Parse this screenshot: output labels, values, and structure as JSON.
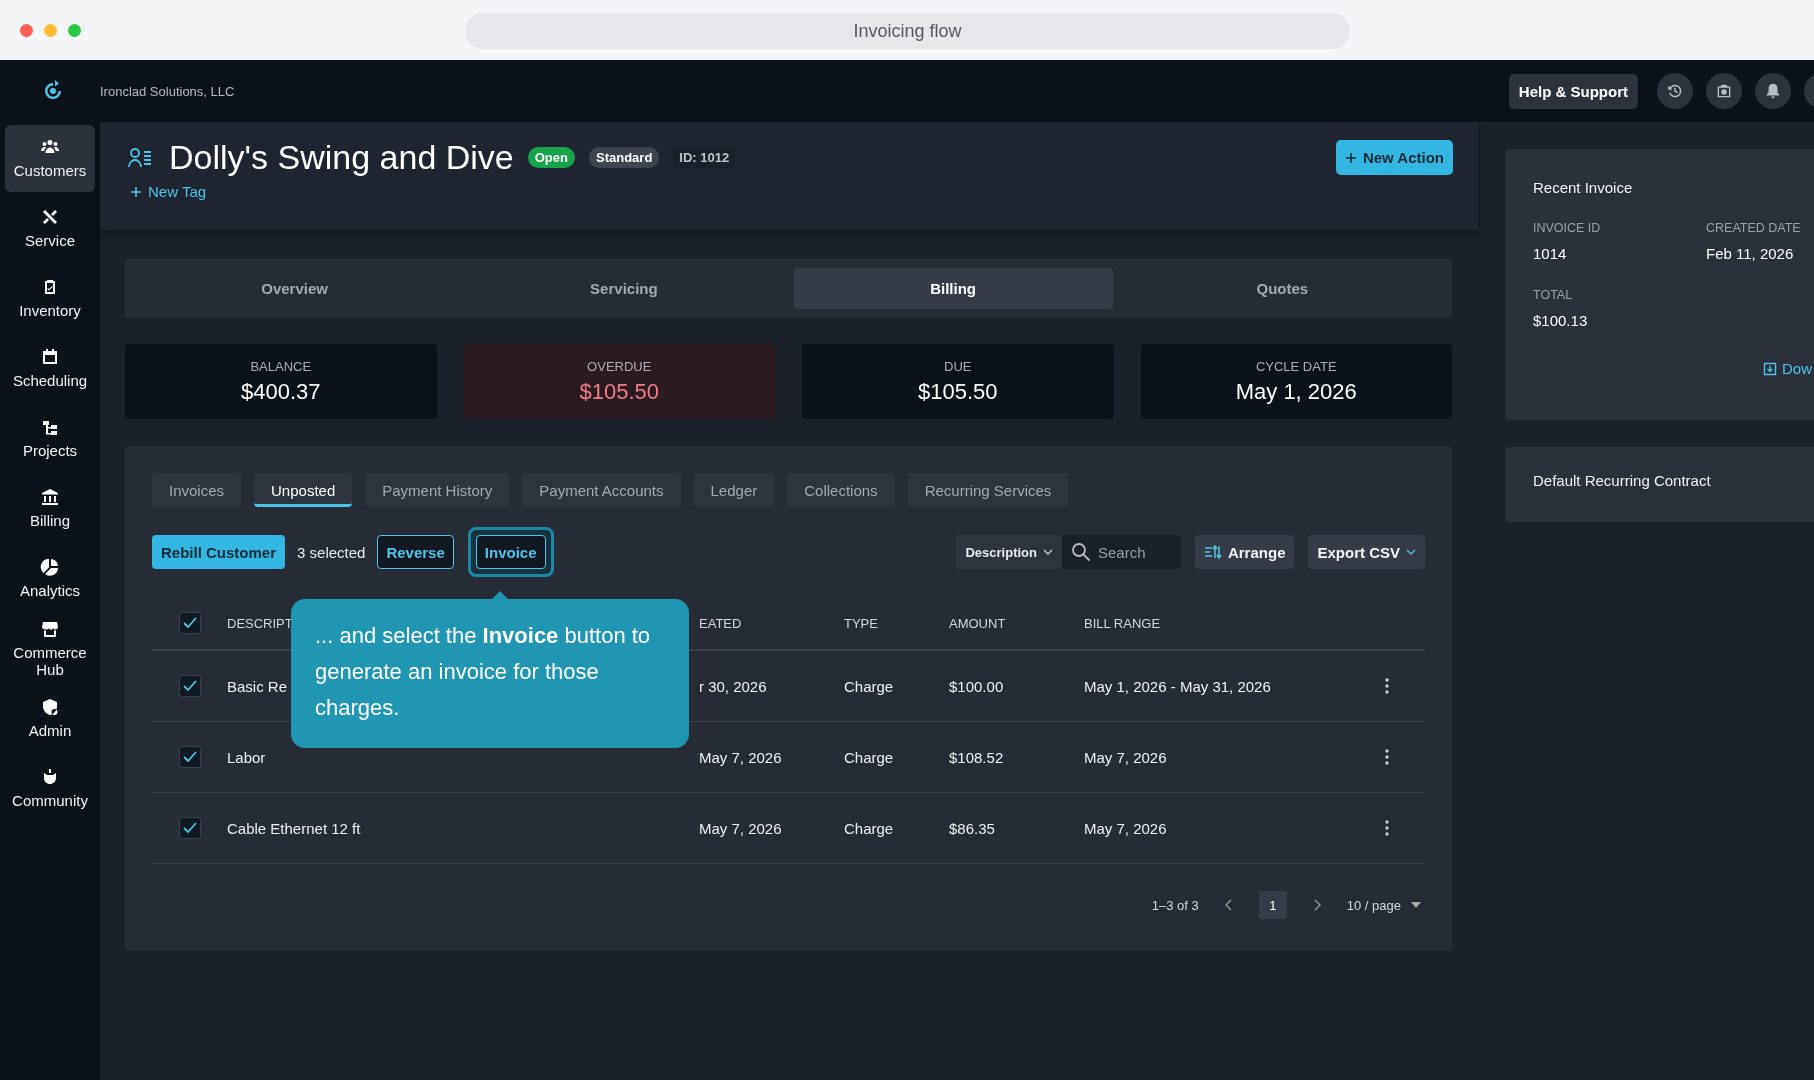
{
  "window": {
    "title": "Invoicing flow"
  },
  "top_bar": {
    "company": "Ironclad Solutions, LLC",
    "help_button": "Help & Support"
  },
  "sidebar": {
    "items": [
      {
        "label": "Customers",
        "selected": true
      },
      {
        "label": "Service",
        "selected": false
      },
      {
        "label": "Inventory",
        "selected": false
      },
      {
        "label": "Scheduling",
        "selected": false
      },
      {
        "label": "Projects",
        "selected": false
      },
      {
        "label": "Billing",
        "selected": false
      },
      {
        "label": "Analytics",
        "selected": false
      },
      {
        "label": "Commerce Hub",
        "selected": false
      },
      {
        "label": "Admin",
        "selected": false
      },
      {
        "label": "Community",
        "selected": false
      }
    ]
  },
  "customer": {
    "name": "Dolly's Swing and Dive",
    "tags": [
      {
        "label": "Open",
        "color": "#16a34a"
      },
      {
        "label": "Standard",
        "color": "#3d444f"
      }
    ],
    "id_label": "ID: 1012",
    "new_tag": "New Tag",
    "new_action": "New Action"
  },
  "tabs": [
    {
      "label": "Overview",
      "selected": false
    },
    {
      "label": "Servicing",
      "selected": false
    },
    {
      "label": "Billing",
      "selected": true
    },
    {
      "label": "Quotes",
      "selected": false
    }
  ],
  "stats": [
    {
      "label": "BALANCE",
      "value": "$400.37",
      "overdue": false
    },
    {
      "label": "OVERDUE",
      "value": "$105.50",
      "overdue": true
    },
    {
      "label": "DUE",
      "value": "$105.50",
      "overdue": false
    },
    {
      "label": "CYCLE DATE",
      "value": "May 1, 2026",
      "overdue": false
    }
  ],
  "billing": {
    "subtabs": [
      {
        "label": "Invoices",
        "selected": false
      },
      {
        "label": "Unposted",
        "selected": true
      },
      {
        "label": "Payment History",
        "selected": false
      },
      {
        "label": "Payment Accounts",
        "selected": false
      },
      {
        "label": "Ledger",
        "selected": false
      },
      {
        "label": "Collections",
        "selected": false
      },
      {
        "label": "Recurring Services",
        "selected": false
      }
    ],
    "toolbar": {
      "rebill": "Rebill Customer",
      "selected_count": "3 selected",
      "reverse": "Reverse",
      "invoice": "Invoice",
      "filter": "Description",
      "search_placeholder": "Search",
      "arrange": "Arrange",
      "export": "Export CSV"
    },
    "table": {
      "select_all": {
        "checked": true
      },
      "columns": [
        "DESCRIPT",
        "EATED",
        "TYPE",
        "AMOUNT",
        "BILL RANGE"
      ],
      "rows": [
        {
          "checked": true,
          "cells": [
            "Basic Re",
            "r 30, 2026",
            "Charge",
            "$100.00",
            "May 1, 2026 - May 31, 2026"
          ]
        },
        {
          "checked": true,
          "cells": [
            "Labor",
            "May 7, 2026",
            "Charge",
            "$108.52",
            "May 7, 2026"
          ]
        },
        {
          "checked": true,
          "cells": [
            "Cable Ethernet 12 ft",
            "May 7, 2026",
            "Charge",
            "$86.35",
            "May 7, 2026"
          ]
        }
      ]
    },
    "pagination": {
      "range": "1–3 of 3",
      "pages": [
        {
          "label": "1",
          "selected": true
        }
      ],
      "page_size": "10 / page"
    }
  },
  "tooltip": {
    "text": "... and select the **Invoice** button to generate an invoice for those charges."
  },
  "recent_invoice": {
    "title": "Recent Invoice",
    "fields": [
      {
        "label": "INVOICE ID",
        "value": "1014"
      },
      {
        "label": "CREATED DATE",
        "value": "Feb 11, 2026"
      },
      {
        "label": "TOTAL",
        "value": "$100.13"
      }
    ],
    "link": "Dow"
  },
  "contract": {
    "title": "Default Recurring Contract"
  }
}
